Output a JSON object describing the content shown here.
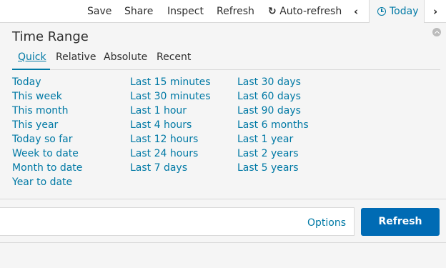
{
  "toolbar": {
    "save": "Save",
    "share": "Share",
    "inspect": "Inspect",
    "refresh": "Refresh",
    "auto_refresh": "Auto-refresh",
    "today": "Today"
  },
  "panel": {
    "title": "Time Range",
    "tabs": [
      "Quick",
      "Relative",
      "Absolute",
      "Recent"
    ],
    "active_tab": "Quick",
    "columns": [
      [
        "Today",
        "This week",
        "This month",
        "This year",
        "Today so far",
        "Week to date",
        "Month to date",
        "Year to date"
      ],
      [
        "Last 15 minutes",
        "Last 30 minutes",
        "Last 1 hour",
        "Last 4 hours",
        "Last 12 hours",
        "Last 24 hours",
        "Last 7 days"
      ],
      [
        "Last 30 days",
        "Last 60 days",
        "Last 90 days",
        "Last 6 months",
        "Last 1 year",
        "Last 2 years",
        "Last 5 years"
      ]
    ]
  },
  "actions": {
    "options": "Options",
    "refresh_button": "Refresh"
  },
  "colors": {
    "accent": "#0079a5",
    "primary_button": "#006bb4"
  }
}
